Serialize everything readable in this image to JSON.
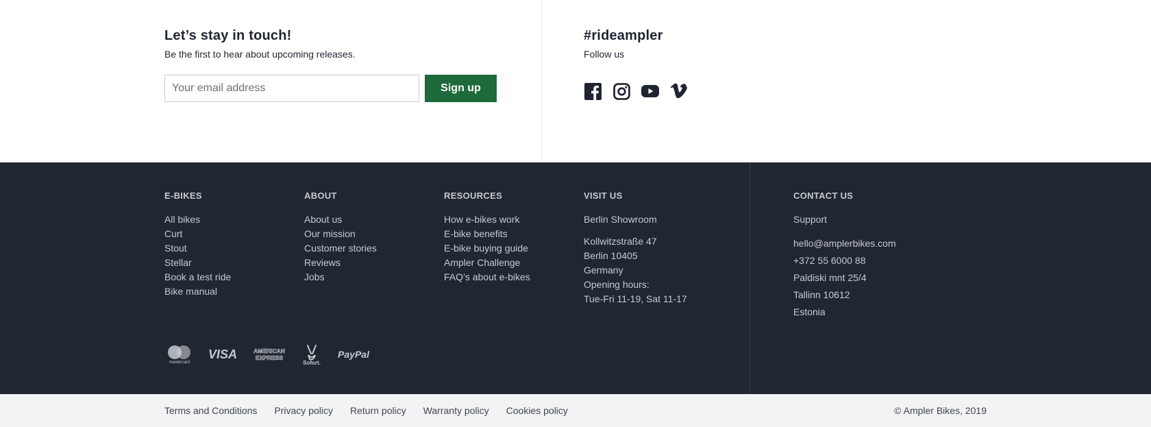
{
  "newsletter": {
    "heading": "Let’s stay in touch!",
    "subtext": "Be the first to hear about upcoming releases.",
    "email_placeholder": "Your email address",
    "email_value": "",
    "signup_label": "Sign up",
    "button_color": "#1d6a3b"
  },
  "social": {
    "heading": "#rideampler",
    "subtext": "Follow us",
    "icons": [
      "facebook-icon",
      "instagram-icon",
      "youtube-icon",
      "vimeo-icon"
    ]
  },
  "footer": {
    "background": "#212731",
    "ebikes": {
      "heading": "E-BIKES",
      "links": [
        "All bikes",
        "Curt",
        "Stout",
        "Stellar",
        "Book a test ride",
        "Bike manual"
      ]
    },
    "about": {
      "heading": "ABOUT",
      "links": [
        "About us",
        "Our mission",
        "Customer stories",
        "Reviews",
        "Jobs"
      ]
    },
    "resources": {
      "heading": "RESOURCES",
      "links": [
        "How e-bikes work",
        "E-bike benefits",
        "E-bike buying guide",
        "Ampler Challenge",
        "FAQ’s about e-bikes"
      ]
    },
    "visit": {
      "heading": "VISIT US",
      "showroom": "Berlin Showroom",
      "address": [
        "Kollwitzstraße 47",
        "Berlin 10405",
        "Germany",
        "Opening hours:",
        "Tue-Fri 11-19, Sat 11-17"
      ]
    },
    "contact": {
      "heading": "CONTACT US",
      "support": "Support",
      "details": [
        "hello@amplerbikes.com",
        "+372 55 6000 88",
        "Paldiski mnt 25/4",
        "Tallinn 10612",
        "Estonia"
      ]
    },
    "payments": {
      "mastercard_label": "mastercard",
      "visa_label": "VISA",
      "amex_line1": "AMERICAN",
      "amex_line2": "EXPRESS",
      "sofort_label": "Sofort.",
      "paypal_label": "PayPal"
    }
  },
  "legal": {
    "links": [
      "Terms and Conditions",
      "Privacy policy",
      "Return policy",
      "Warranty policy",
      "Cookies policy"
    ],
    "copyright": "© Ampler Bikes, 2019"
  }
}
